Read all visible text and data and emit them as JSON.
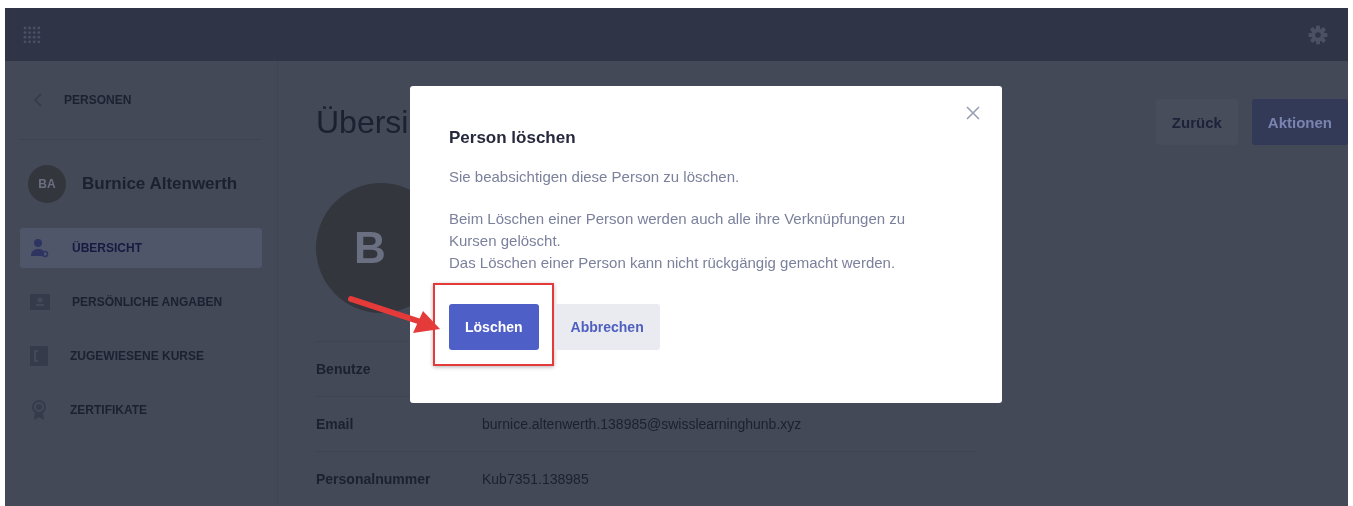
{
  "sidebar": {
    "back_label": "PERSONEN",
    "person": {
      "initials": "BA",
      "name": "Burnice Altenwerth"
    },
    "items": [
      {
        "label": "ÜBERSICHT",
        "selected": true
      },
      {
        "label": "PERSÖNLICHE ANGABEN",
        "selected": false
      },
      {
        "label": "ZUGEWIESENE KURSE",
        "selected": false
      },
      {
        "label": "ZERTIFIKATE",
        "selected": false
      }
    ]
  },
  "main": {
    "title": "Übersi",
    "actions": [
      {
        "label": "Zurück",
        "kind": "secondary"
      },
      {
        "label": "Aktionen",
        "kind": "primary"
      }
    ],
    "avatar_letter": "B",
    "fields": [
      {
        "label": "Benutze"
      },
      {
        "label": "Email",
        "value": "burnice.altenwerth.138985@swisslearninghunb.xyz"
      },
      {
        "label": "Personalnummer",
        "value": "Kub7351.138985"
      }
    ]
  },
  "dialog": {
    "title": "Person löschen",
    "paragraphs": [
      [
        "Sie beabsichtigen diese Person zu löschen."
      ],
      [
        "Beim Löschen einer Person werden auch alle ihre Verknüpfungen zu Kursen gelöscht.",
        "Das Löschen einer Person kann nicht rückgängig gemacht werden."
      ]
    ],
    "buttons": [
      {
        "label": "Löschen",
        "kind": "primary",
        "highlighted": true
      },
      {
        "label": "Abbrechen",
        "kind": "secondary",
        "highlighted": false
      }
    ]
  }
}
